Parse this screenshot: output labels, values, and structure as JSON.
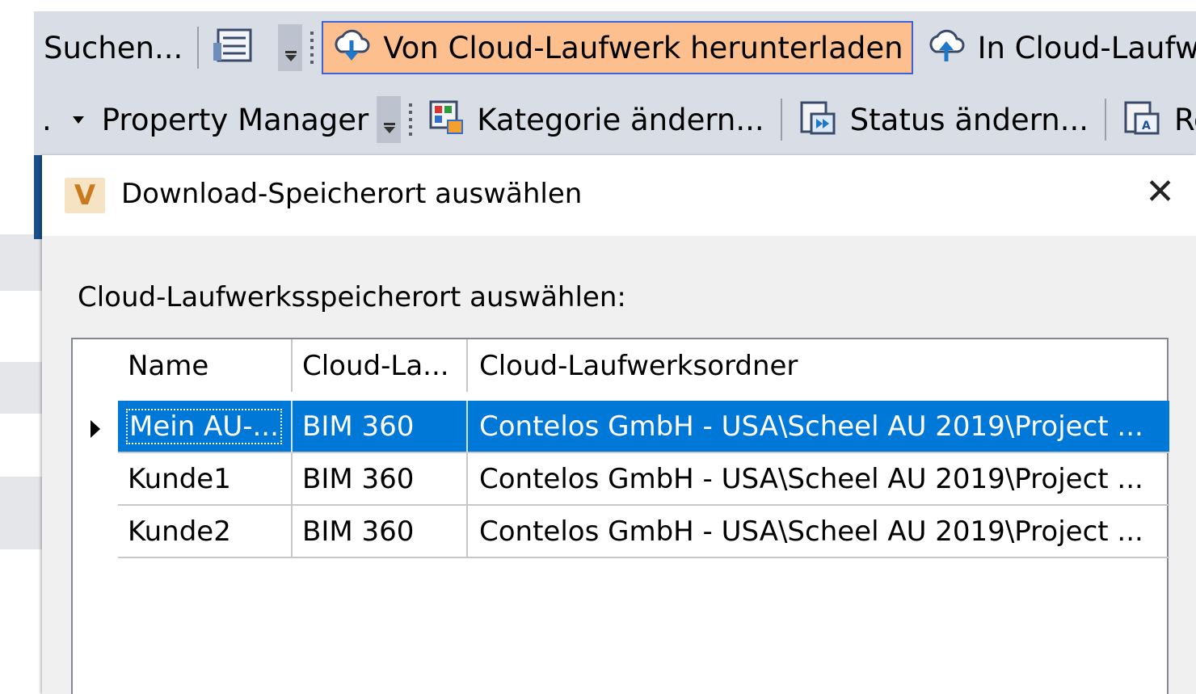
{
  "toolbar_row1": {
    "search_label": "Suchen...",
    "download_label": "Von Cloud-Laufwerk herunterladen",
    "upload_label": "In Cloud-Laufwe"
  },
  "toolbar_row2": {
    "dot_label": ".",
    "property_manager_label": "Property Manager",
    "change_category_label": "Kategorie ändern...",
    "change_status_label": "Status ändern...",
    "partial_label": "Re"
  },
  "dialog": {
    "title": "Download-Speicherort auswählen",
    "app_logo_letter": "V",
    "close_symbol": "✕",
    "prompt": "Cloud-Laufwerksspeicherort auswählen:",
    "columns": [
      "Name",
      "Cloud-La...",
      "Cloud-Laufwerksordner"
    ],
    "rows": [
      {
        "name": "Mein AU-...",
        "drive": "BIM 360",
        "folder": "Contelos GmbH - USA\\Scheel AU 2019\\Project ...",
        "selected": true
      },
      {
        "name": "Kunde1",
        "drive": "BIM 360",
        "folder": "Contelos GmbH - USA\\Scheel AU 2019\\Project ...",
        "selected": false
      },
      {
        "name": "Kunde2",
        "drive": "BIM 360",
        "folder": "Contelos GmbH - USA\\Scheel AU 2019\\Project ...",
        "selected": false
      }
    ]
  },
  "colors": {
    "toolbar_bg": "#d9dde6",
    "highlight_button_bg": "#fdbf8d",
    "highlight_button_border": "#3c63d6",
    "selection_bg": "#0078d7",
    "dialog_bg": "#f0f0f0"
  },
  "icons": [
    "list-view-icon",
    "cloud-download-icon",
    "cloud-upload-icon",
    "change-category-icon",
    "change-status-icon",
    "rename-icon",
    "vault-logo-icon",
    "close-icon",
    "row-pointer-icon"
  ]
}
